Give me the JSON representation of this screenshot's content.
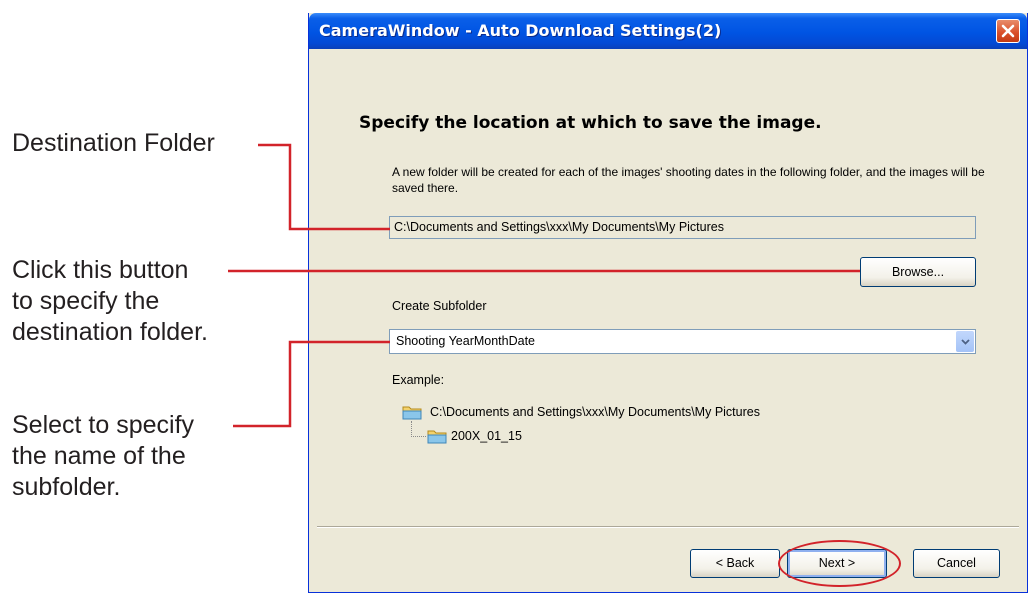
{
  "annotations": {
    "destination_folder": "Destination Folder",
    "browse_hint": [
      "Click this button",
      "to specify the",
      "destination folder."
    ],
    "subfolder_hint": [
      "Select to specify",
      "the name of the",
      "subfolder."
    ]
  },
  "window": {
    "title": "CameraWindow - Auto Download Settings(2)",
    "heading": "Specify the location at which to save the image.",
    "description": "A new folder will be created for each of the images' shooting dates in the following folder, and the images will be saved there.",
    "destination_path": "C:\\Documents and Settings\\xxx\\My Documents\\My Pictures",
    "browse_label": "Browse...",
    "subfolder_label": "Create Subfolder",
    "subfolder_value": "Shooting YearMonthDate",
    "example_label": "Example:",
    "example_root": "C:\\Documents and Settings\\xxx\\My Documents\\My Pictures",
    "example_child": "200X_01_15",
    "back_label": "< Back",
    "next_label": "Next >",
    "cancel_label": "Cancel"
  },
  "colors": {
    "callout_line": "#d2232a",
    "title_bar": "#0054e3",
    "dialog_bg": "#ece9d8"
  }
}
